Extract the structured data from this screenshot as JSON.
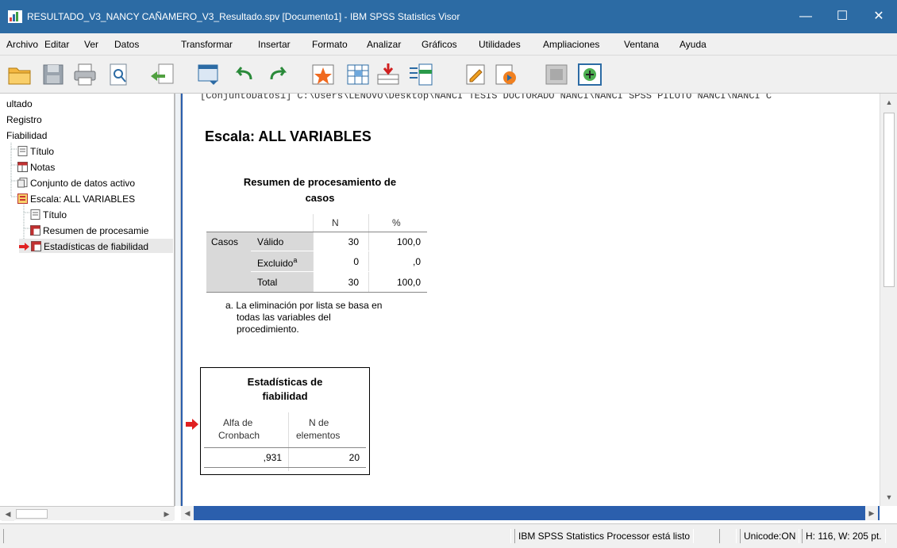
{
  "window": {
    "title": "RESULTADO_V3_NANCY CAÑAMERO_V3_Resultado.spv [Documento1] - IBM SPSS Statistics Visor",
    "minimize": "—",
    "maximize": "☐",
    "close": "✕"
  },
  "menu": [
    "Archivo",
    "Editar",
    "Ver",
    "Datos",
    "Transformar",
    "Insertar",
    "Formato",
    "Analizar",
    "Gráficos",
    "Utilidades",
    "Ampliaciones",
    "Ventana",
    "Ayuda"
  ],
  "toolbar_icons": [
    "open-icon",
    "save-icon",
    "print-icon",
    "print-preview-icon",
    "export-icon",
    "dialog-recall-icon",
    "undo-icon",
    "redo-icon",
    "goto-data-icon",
    "goto-case-icon",
    "insert-output-icon",
    "variables-icon",
    "create-title-icon",
    "designate-window-icon",
    "hide-icon",
    "promote-icon"
  ],
  "tree": {
    "items": [
      {
        "label": "ultado"
      },
      {
        "label": "Registro"
      },
      {
        "label": "Fiabilidad"
      },
      {
        "label": "Título"
      },
      {
        "label": "Notas"
      },
      {
        "label": "Conjunto de datos activo"
      },
      {
        "label": "Escala: ALL VARIABLES"
      },
      {
        "label": "Título"
      },
      {
        "label": "Resumen de procesamie"
      },
      {
        "label": "Estadísticas de fiabilidad"
      }
    ]
  },
  "output": {
    "syntax_line": "[ConjuntoDatos1] C:\\Users\\LENOVO\\Desktop\\NANCI TESIS DOCTORADO NANCI\\NANCI SPSS PILOTO NANCI\\NANCI C",
    "scale_heading": "Escala: ALL VARIABLES",
    "case_summary": {
      "title_line1": "Resumen de procesamiento de",
      "title_line2": "casos",
      "col_n": "N",
      "col_pct": "%",
      "row_group": "Casos",
      "rows": [
        {
          "label": "Válido",
          "n": "30",
          "pct": "100,0"
        },
        {
          "label": "Excluido",
          "sup": "a",
          "n": "0",
          "pct": ",0"
        },
        {
          "label": "Total",
          "n": "30",
          "pct": "100,0"
        }
      ],
      "footnote_line1": "a. La eliminación por lista se basa en",
      "footnote_line2": "todas las variables del",
      "footnote_line3": "procedimiento."
    },
    "reliability": {
      "title_line1": "Estadísticas de",
      "title_line2": "fiabilidad",
      "col1_line1": "Alfa de",
      "col1_line2": "Cronbach",
      "col2_line1": "N de",
      "col2_line2": "elementos",
      "alpha": ",931",
      "n_items": "20"
    }
  },
  "status": {
    "processor": "IBM SPSS Statistics Processor está listo",
    "unicode": "Unicode:ON",
    "size": "H: 116, W: 205 pt."
  },
  "colors": {
    "titlebar": "#2c6ba4",
    "selection_border": "#2b5fad",
    "arrow_red": "#e02020"
  }
}
